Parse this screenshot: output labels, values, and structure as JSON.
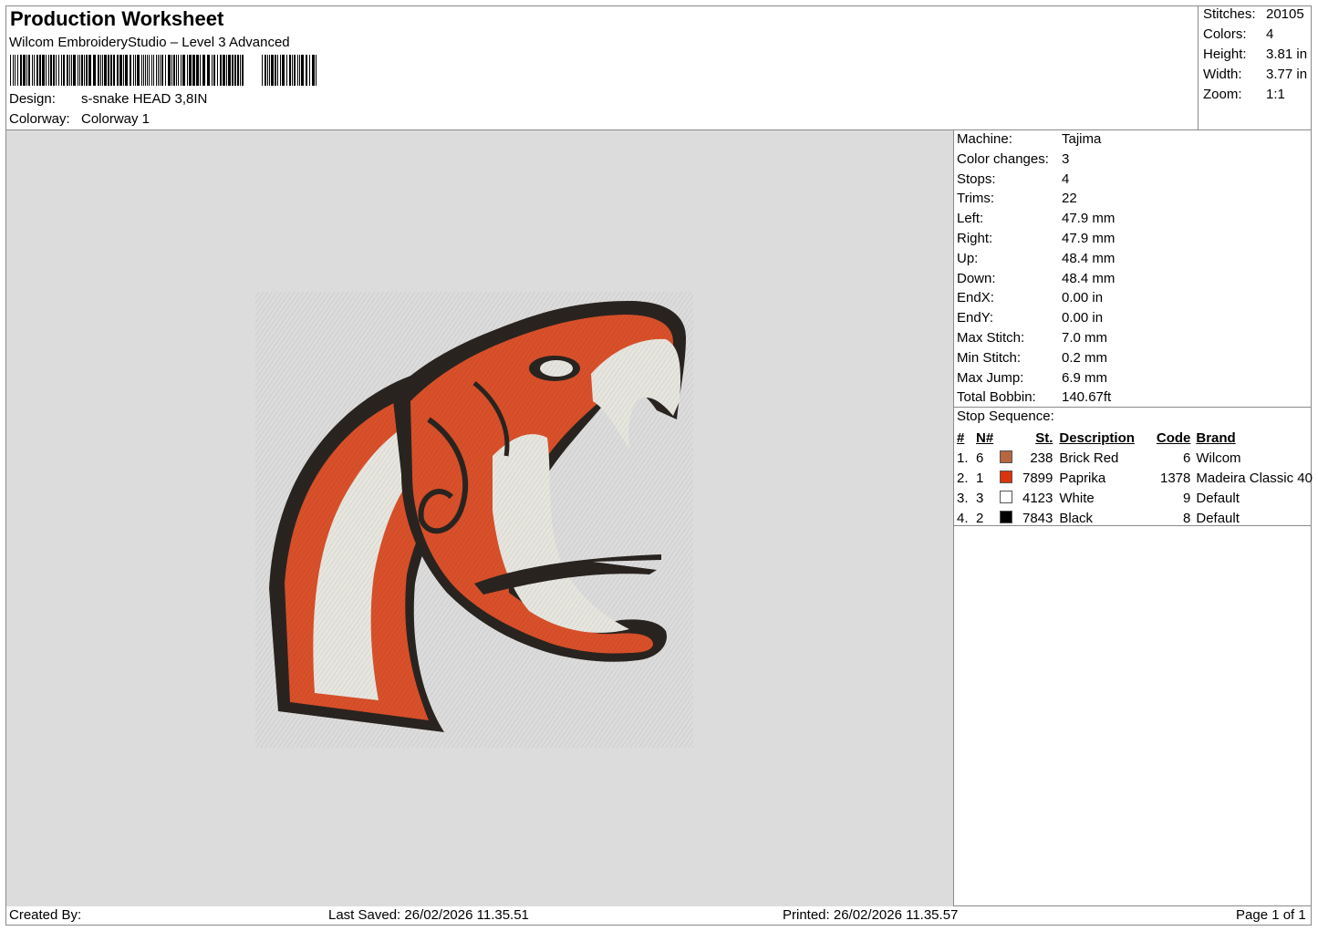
{
  "header": {
    "title": "Production Worksheet",
    "software": "Wilcom EmbroideryStudio – Level 3 Advanced",
    "design_label": "Design:",
    "design_value": "s-snake HEAD 3,8IN",
    "colorway_label": "Colorway:",
    "colorway_value": "Colorway 1"
  },
  "summary": [
    {
      "label": "Stitches:",
      "value": "20105"
    },
    {
      "label": "Colors:",
      "value": "4"
    },
    {
      "label": "Height:",
      "value": "3.81 in"
    },
    {
      "label": "Width:",
      "value": "3.77 in"
    },
    {
      "label": "Zoom:",
      "value": "1:1"
    }
  ],
  "machine_info": [
    {
      "label": "Machine:",
      "value": "Tajima"
    },
    {
      "label": "Color changes:",
      "value": "3"
    },
    {
      "label": "Stops:",
      "value": "4"
    },
    {
      "label": "Trims:",
      "value": "22"
    },
    {
      "label": "Left:",
      "value": "47.9 mm"
    },
    {
      "label": "Right:",
      "value": "47.9 mm"
    },
    {
      "label": "Up:",
      "value": "48.4 mm"
    },
    {
      "label": "Down:",
      "value": "48.4 mm"
    },
    {
      "label": "EndX:",
      "value": "0.00 in"
    },
    {
      "label": "EndY:",
      "value": "0.00 in"
    },
    {
      "label": "Max Stitch:",
      "value": "7.0 mm"
    },
    {
      "label": "Min Stitch:",
      "value": "0.2 mm"
    },
    {
      "label": "Max Jump:",
      "value": "6.9 mm"
    },
    {
      "label": "Total Bobbin:",
      "value": "140.67ft"
    }
  ],
  "stop_sequence": {
    "title": "Stop Sequence:",
    "headers": [
      "#",
      "N#",
      "St.",
      "Description",
      "Code",
      "Brand"
    ],
    "rows": [
      {
        "idx": "1.",
        "n": "6",
        "color": "#b5673f",
        "st": "238",
        "desc": "Brick Red",
        "code": "6",
        "brand": "Wilcom"
      },
      {
        "idx": "2.",
        "n": "1",
        "color": "#d9340f",
        "st": "7899",
        "desc": "Paprika",
        "code": "1378",
        "brand": "Madeira Classic 40"
      },
      {
        "idx": "3.",
        "n": "3",
        "color": "#ffffff",
        "st": "4123",
        "desc": "White",
        "code": "9",
        "brand": "Default"
      },
      {
        "idx": "4.",
        "n": "2",
        "color": "#000000",
        "st": "7843",
        "desc": "Black",
        "code": "8",
        "brand": "Default"
      }
    ]
  },
  "footer": {
    "created_by": "Created By:",
    "last_saved": "Last Saved: 26/02/2026 11.35.51",
    "printed": "Printed: 26/02/2026 11.35.57",
    "page": "Page 1 of 1"
  },
  "colors": {
    "canvas_bg": "#dcdcdc",
    "snake_orange": "#d9502a",
    "snake_black": "#2a2420",
    "snake_white": "#e6e6df"
  }
}
